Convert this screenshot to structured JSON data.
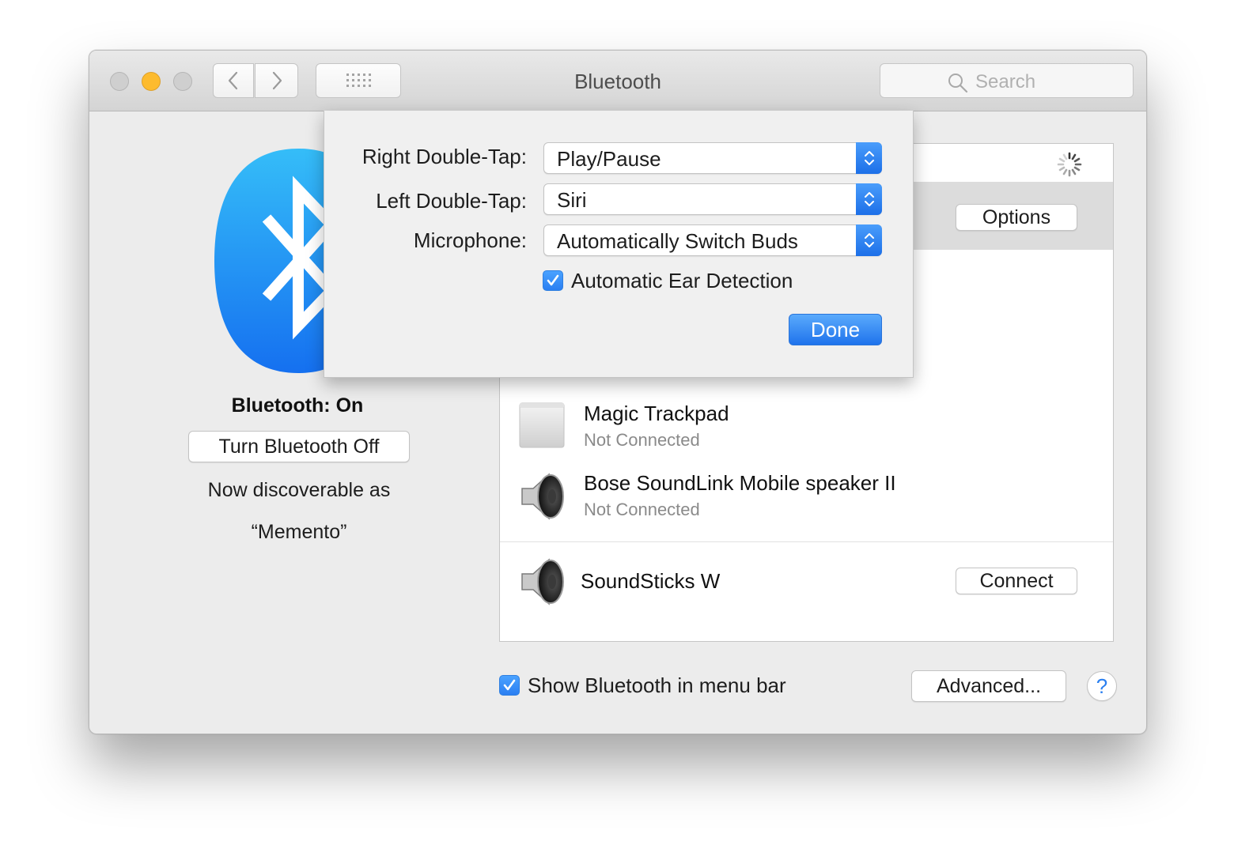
{
  "window": {
    "title": "Bluetooth",
    "search_placeholder": "Search"
  },
  "left_panel": {
    "status": "Bluetooth: On",
    "toggle_button": "Turn Bluetooth Off",
    "discoverable_line1": "Now discoverable as",
    "discoverable_name": "“Memento”"
  },
  "devices": {
    "selected_options_button": "Options",
    "items": [
      {
        "name": "Magic Trackpad",
        "status": "Not Connected",
        "icon": "trackpad-icon"
      },
      {
        "name": "Bose SoundLink Mobile speaker II",
        "status": "Not Connected",
        "icon": "speaker-icon"
      }
    ],
    "other": {
      "name": "SoundSticks W",
      "icon": "speaker-icon",
      "button": "Connect"
    }
  },
  "footer": {
    "show_in_menu_bar": "Show Bluetooth in menu bar",
    "show_in_menu_bar_checked": true,
    "advanced_button": "Advanced...",
    "help_button": "?"
  },
  "options_sheet": {
    "right_double_tap_label": "Right Double-Tap:",
    "right_double_tap_value": "Play/Pause",
    "left_double_tap_label": "Left Double-Tap:",
    "left_double_tap_value": "Siri",
    "microphone_label": "Microphone:",
    "microphone_value": "Automatically Switch Buds",
    "ear_detection_label": "Automatic Ear Detection",
    "ear_detection_checked": true,
    "done_button": "Done"
  },
  "colors": {
    "accent": "#2b7ff2",
    "traffic_minimize": "#fdbb2e",
    "bluetooth_logo": "#1e8cf7"
  }
}
